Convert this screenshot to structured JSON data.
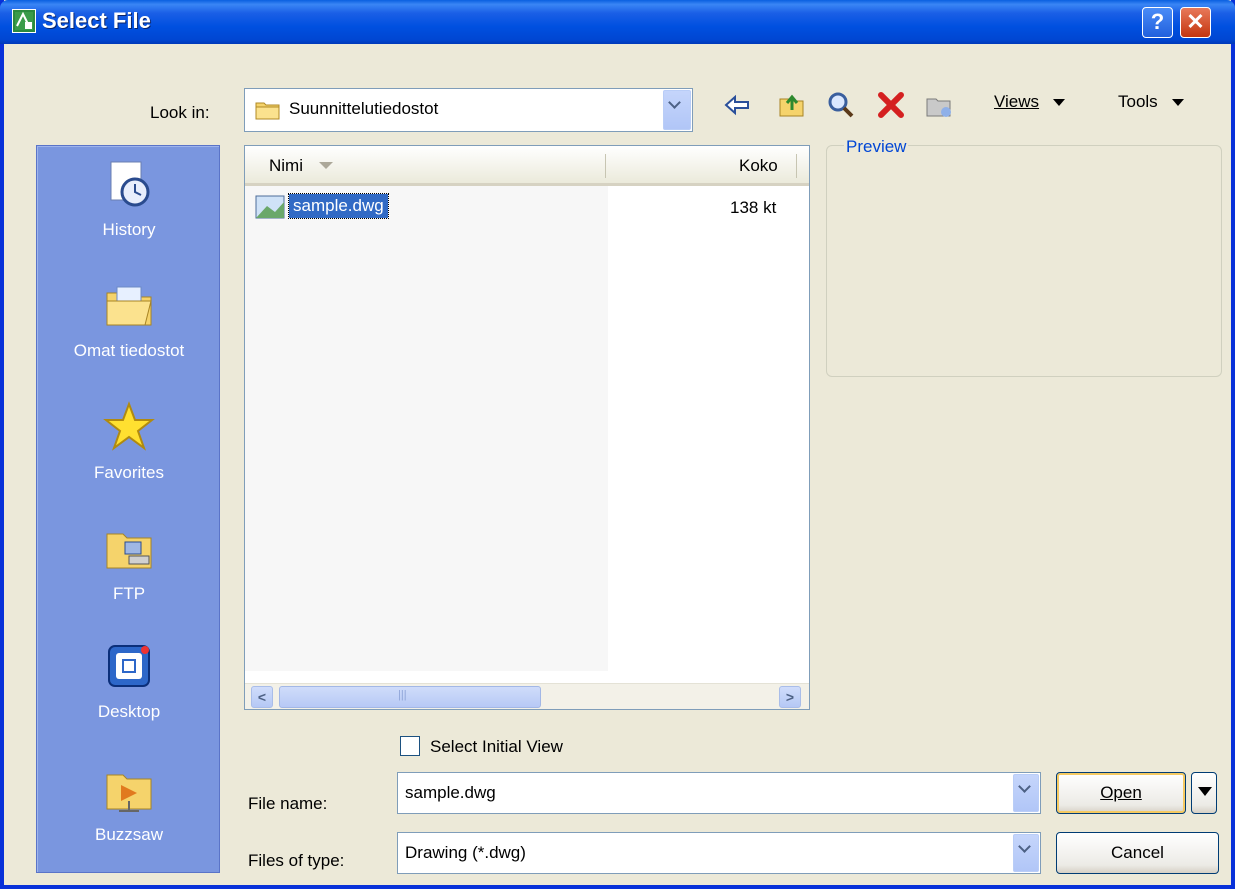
{
  "window": {
    "title": "Select File",
    "help_label": "?",
    "close_label": "✕"
  },
  "lookin": {
    "label": "Look in:",
    "value": "Suunnittelutiedostot"
  },
  "toolbar": {
    "icons": [
      "back-icon",
      "up-folder-icon",
      "search-web-icon",
      "delete-icon",
      "create-folder-icon"
    ],
    "views_label": "Views",
    "tools_label": "Tools"
  },
  "places": [
    {
      "label": "History",
      "icon": "history-icon"
    },
    {
      "label": "Omat tiedostot",
      "icon": "my-documents-icon"
    },
    {
      "label": "Favorites",
      "icon": "favorites-icon"
    },
    {
      "label": "FTP",
      "icon": "ftp-icon"
    },
    {
      "label": "Desktop",
      "icon": "desktop-icon"
    },
    {
      "label": "Buzzsaw",
      "icon": "buzzsaw-icon"
    }
  ],
  "filelist": {
    "columns": [
      "Nimi",
      "Koko"
    ],
    "rows": [
      {
        "name": "sample.dwg",
        "size": "138 kt"
      }
    ],
    "scroll_grip": "III"
  },
  "preview": {
    "label": "Preview"
  },
  "options": {
    "select_initial_view": "Select Initial View"
  },
  "filename": {
    "label": "File name:",
    "value": "sample.dwg"
  },
  "filetype": {
    "label": "Files of type:",
    "value": "Drawing (*.dwg)"
  },
  "buttons": {
    "open": "Open",
    "cancel": "Cancel"
  },
  "colors": {
    "title_blue": "#0054e3",
    "places_bg": "#7a96df",
    "selection": "#316ac5",
    "preview_text": "#0046d5"
  }
}
